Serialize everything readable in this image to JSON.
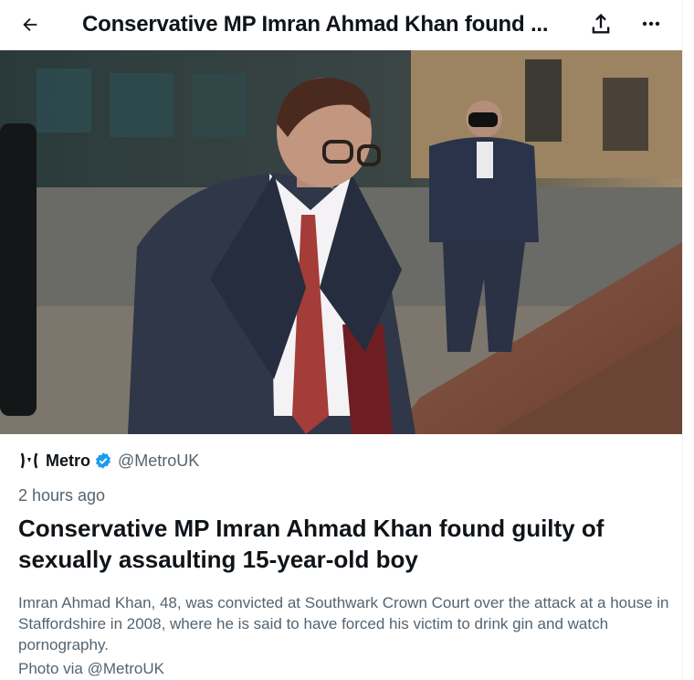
{
  "header": {
    "title": "Conservative MP Imran Ahmad Khan found ...",
    "back_icon": "arrow-left-icon",
    "share_icon": "share-icon",
    "more_icon": "more-horizontal-icon"
  },
  "article": {
    "source_name": "Metro",
    "source_handle": "@MetroUK",
    "verified_color": "#1d9bf0",
    "timestamp": "2 hours ago",
    "headline": "Conservative MP Imran Ahmad Khan found guilty of sexually assaulting 15-year-old boy",
    "description": "Imran Ahmad Khan, 48, was convicted at Southwark Crown Court over the attack at a house in Staffordshire in 2008, where he is said to have forced his victim to drink gin and watch pornography.",
    "credit": "Photo via @MetroUK"
  }
}
